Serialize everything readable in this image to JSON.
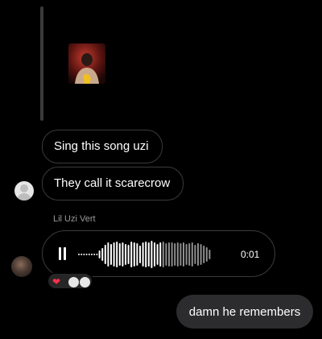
{
  "thread": {
    "shared_media": {
      "icon": "album-cover-thumbnail"
    },
    "messages": [
      {
        "id": "m1",
        "text": "Sing this song uzi"
      },
      {
        "id": "m2",
        "text": "They call it scarecrow"
      }
    ],
    "voice_message": {
      "sender": "Lil Uzi Vert",
      "duration": "0:01",
      "state": "playing",
      "control_icon": "pause-icon",
      "reactions": {
        "emoji": "❤",
        "reactor_avatar_count": 2
      }
    },
    "outgoing": {
      "text": "damn he remembers"
    }
  },
  "colors": {
    "background": "#000000",
    "bubble_border": "#3b3b3b",
    "outgoing_bubble": "#2c2c2e",
    "secondary_text": "#9a9a9a",
    "heart": "#ff2f4b"
  }
}
